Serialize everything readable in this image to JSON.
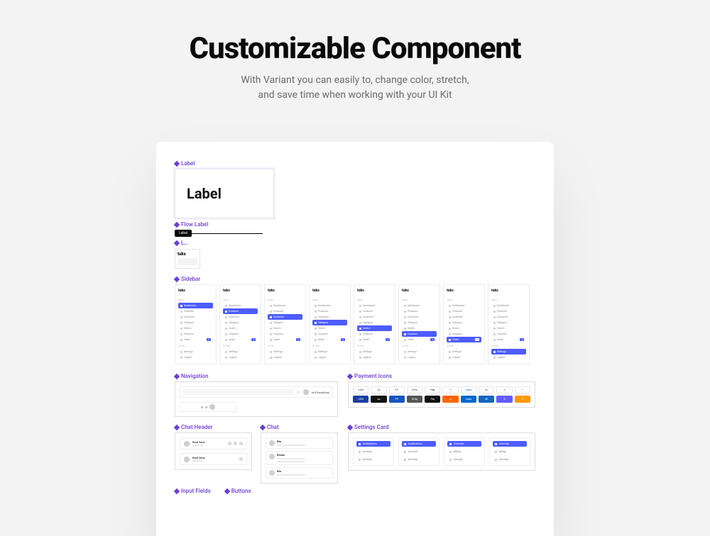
{
  "hero": {
    "title": "Customizable Component",
    "subtitle": "With Variant you can easily to, change color, stretch,\nand save time when working with your UI Kit"
  },
  "sections": {
    "label": "Label",
    "flowLabel": "Flow Label",
    "sidebar": "Sidebar",
    "navigation": "Navigation",
    "paymentIcons": "Payment Icons",
    "chatHeader": "Chat Header",
    "chat": "Chat",
    "settingsCard": "Settings Card",
    "inputFields": "Input Fields",
    "buttons": "Buttons"
  },
  "labelCard": {
    "text": "Label"
  },
  "flowChip": {
    "text": "Label"
  },
  "logoSmall": "tuks",
  "sidebarItems": {
    "menuHeading": "MENU",
    "otherHeading": "OTHER",
    "items": [
      "Dashboard",
      "Products",
      "Customer",
      "Category",
      "Orders",
      "Coupons",
      "Chats"
    ],
    "other": [
      "Settings",
      "Logout"
    ]
  },
  "sidebarVariants": [
    {
      "activeIndex": 0,
      "badgeIndex": 6
    },
    {
      "activeIndex": 1,
      "badgeIndex": 6
    },
    {
      "activeIndex": 2,
      "badgeIndex": 6
    },
    {
      "activeIndex": 3,
      "badgeIndex": 6
    },
    {
      "activeIndex": 4,
      "badgeIndex": 6
    },
    {
      "activeIndex": 5,
      "badgeIndex": 6
    },
    {
      "activeIndex": 6,
      "badgeIndex": 6,
      "activeBadge": true
    },
    {
      "activeIndex": null,
      "badgeIndex": 6,
      "activeOther": 0
    }
  ],
  "navigation": {
    "user": "Arif Ramdhani"
  },
  "payment": {
    "row1": [
      {
        "label": "VISA",
        "bg": "#ffffff",
        "fg": "#1a3ea1"
      },
      {
        "label": "●●",
        "bg": "#ffffff",
        "fg": "#e33"
      },
      {
        "label": "PP",
        "bg": "#ffffff",
        "fg": "#1554c1"
      },
      {
        "label": "GPay",
        "bg": "#ffffff",
        "fg": "#555"
      },
      {
        "label": "Pay",
        "bg": "#ffffff",
        "fg": "#111"
      },
      {
        "label": "D",
        "bg": "#ffffff",
        "fg": "#f60"
      },
      {
        "label": "maes",
        "bg": "#ffffff",
        "fg": "#06c"
      },
      {
        "label": "AE",
        "bg": "#ffffff",
        "fg": "#1565c0"
      },
      {
        "label": "S",
        "bg": "#ffffff",
        "fg": "#635bff"
      },
      {
        "label": "A",
        "bg": "#ffffff",
        "fg": "#ff9900"
      }
    ],
    "row2": [
      {
        "label": "VISA",
        "bg": "#1a3ea1"
      },
      {
        "label": "●●",
        "bg": "#111"
      },
      {
        "label": "PP",
        "bg": "#1554c1"
      },
      {
        "label": "GPay",
        "bg": "#555"
      },
      {
        "label": "Pay",
        "bg": "#111"
      },
      {
        "label": "D",
        "bg": "#f60"
      },
      {
        "label": "maes",
        "bg": "#06c"
      },
      {
        "label": "AE",
        "bg": "#1565c0"
      },
      {
        "label": "S",
        "bg": "#635bff"
      },
      {
        "label": "A",
        "bg": "#ff9900"
      }
    ]
  },
  "chatHeader": {
    "name1": "Raul Sanz",
    "sub1": "Online now",
    "name2": "Raul Sanz",
    "sub2": "Online now"
  },
  "chat": {
    "n1": "Rita",
    "n2": "Renata"
  },
  "settings": {
    "items": [
      "Notifications",
      "Account",
      "Security"
    ],
    "extra": [
      "Overview",
      "Billing"
    ]
  }
}
